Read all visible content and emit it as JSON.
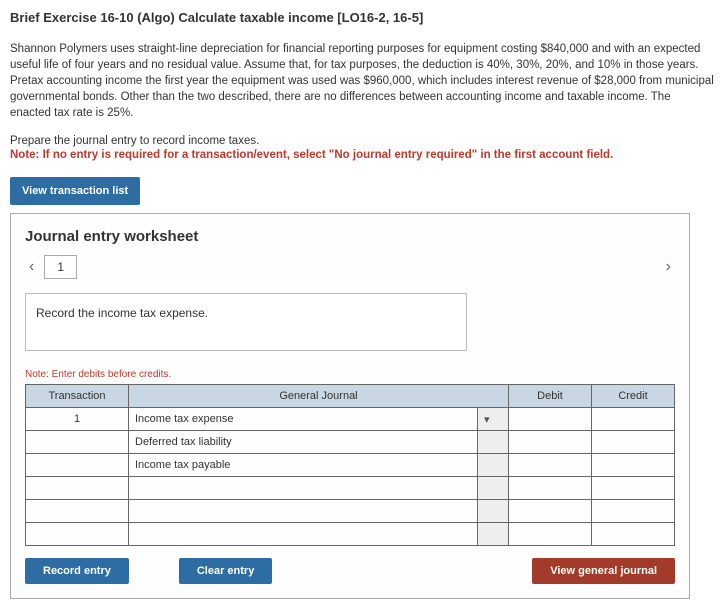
{
  "title": "Brief Exercise 16-10 (Algo) Calculate taxable income [LO16-2, 16-5]",
  "description": "Shannon Polymers uses straight-line depreciation for financial reporting purposes for equipment costing $840,000 and with an expected useful life of four years and no residual value. Assume that, for tax purposes, the deduction is 40%, 30%, 20%, and 10% in those years. Pretax accounting income the first year the equipment was used was $960,000, which includes interest revenue of $28,000 from municipal governmental bonds. Other than the two described, there are no differences between accounting income and taxable income. The enacted tax rate is 25%.",
  "instruction": "Prepare the journal entry to record income taxes.",
  "note_prefix": "Note: ",
  "note_text": "If no entry is required for a transaction/event, select \"No journal entry required\" in the first account field.",
  "view_list_btn": "View transaction list",
  "worksheet_title": "Journal entry worksheet",
  "tab_number": "1",
  "record_instruction": "Record the income tax expense.",
  "table_note": "Note: Enter debits before credits.",
  "headers": {
    "transaction": "Transaction",
    "general_journal": "General Journal",
    "debit": "Debit",
    "credit": "Credit"
  },
  "rows": [
    {
      "no": "1",
      "account": "Income tax expense"
    },
    {
      "no": "",
      "account": "Deferred tax liability"
    },
    {
      "no": "",
      "account": "Income tax payable"
    },
    {
      "no": "",
      "account": ""
    },
    {
      "no": "",
      "account": ""
    },
    {
      "no": "",
      "account": ""
    }
  ],
  "buttons": {
    "record": "Record entry",
    "clear": "Clear entry",
    "view_general": "View general journal"
  }
}
